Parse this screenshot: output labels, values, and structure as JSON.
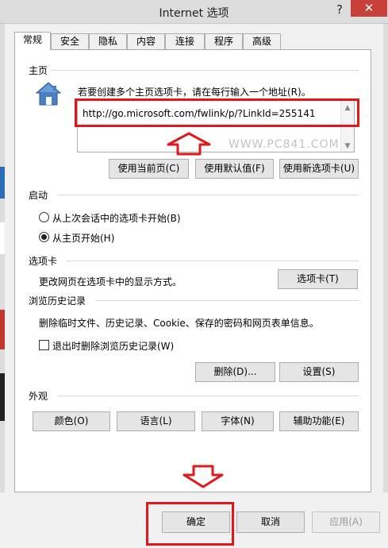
{
  "window": {
    "title": "Internet 选项",
    "help_glyph": "?",
    "close_glyph": "✕"
  },
  "tabs": [
    {
      "label": "常规"
    },
    {
      "label": "安全"
    },
    {
      "label": "隐私"
    },
    {
      "label": "内容"
    },
    {
      "label": "连接"
    },
    {
      "label": "程序"
    },
    {
      "label": "高级"
    }
  ],
  "home": {
    "group_label": "主页",
    "description": "若要创建多个主页选项卡，请在每行输入一个地址(R)。",
    "url": "http://go.microsoft.com/fwlink/p/?LinkId=255141",
    "watermark": "WWW.PC841.COM",
    "buttons": {
      "current": "使用当前页(C)",
      "default": "使用默认值(F)",
      "new_tab": "使用新选项卡(U)"
    }
  },
  "startup": {
    "group_label": "启动",
    "option_last_session": "从上次会话中的选项卡开始(B)",
    "option_home": "从主页开始(H)",
    "selected": "home"
  },
  "tabs_section": {
    "group_label": "选项卡",
    "description": "更改网页在选项卡中的显示方式。",
    "button": "选项卡(T)"
  },
  "history": {
    "group_label": "浏览历史记录",
    "description": "删除临时文件、历史记录、Cookie、保存的密码和网页表单信息。",
    "checkbox_label": "退出时删除浏览历史记录(W)",
    "checked": false,
    "delete_button": "删除(D)...",
    "settings_button": "设置(S)"
  },
  "appearance": {
    "group_label": "外观",
    "colors": "颜色(O)",
    "languages": "语言(L)",
    "fonts": "字体(N)",
    "accessibility": "辅助功能(E)"
  },
  "footer": {
    "ok": "确定",
    "cancel": "取消",
    "apply": "应用(A)"
  },
  "colors": {
    "annotation_red": "#e0181b",
    "close_red": "#c7413a"
  }
}
